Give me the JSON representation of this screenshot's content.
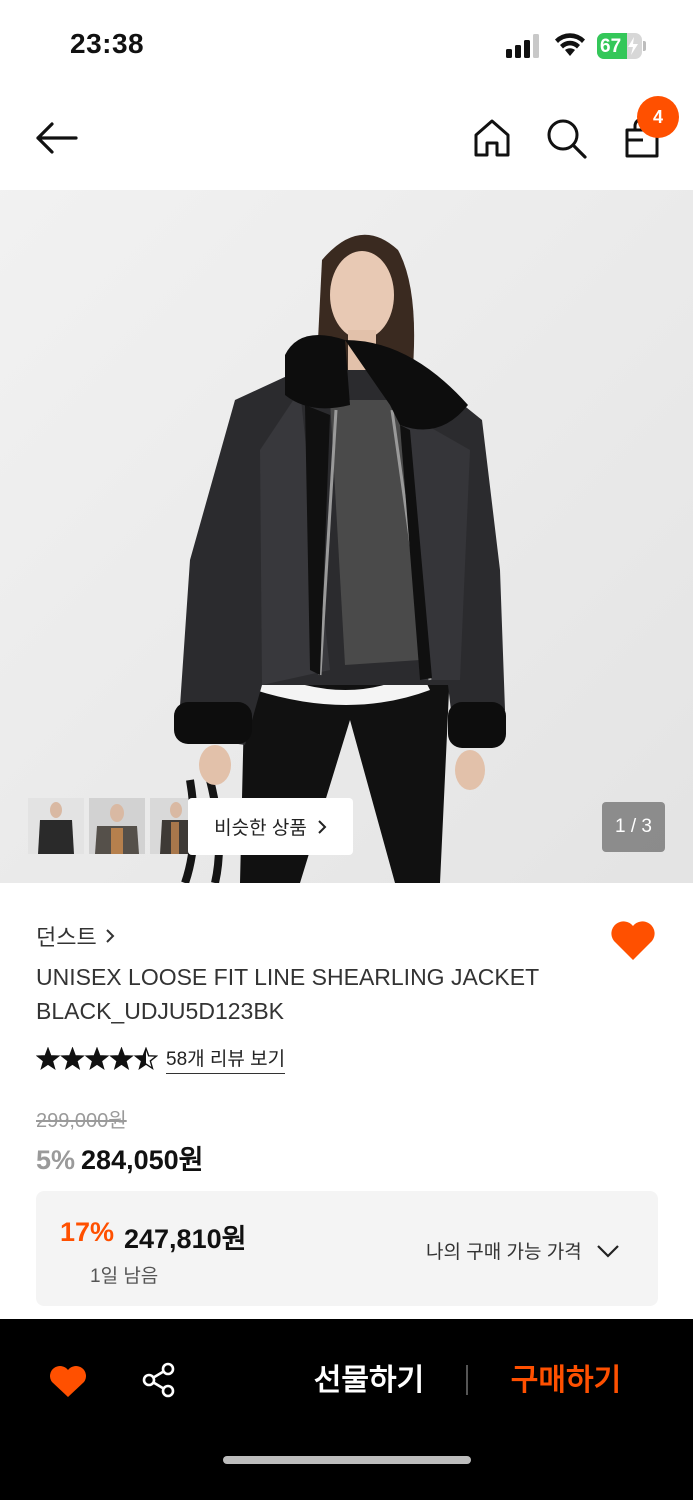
{
  "status_bar": {
    "time": "23:38",
    "battery": "67",
    "battery_level": 0.67
  },
  "header": {
    "cart_count": "4"
  },
  "gallery": {
    "similar_label": "비슷한 상품",
    "counter": "1 / 3"
  },
  "product": {
    "brand": "던스트",
    "name": "UNISEX LOOSE FIT LINE SHEARLING JACKET BLACK_UDJU5D123BK",
    "rating": 4.5,
    "review_link": "58개 리뷰 보기",
    "original_price": "299,000원",
    "discount_rate": "5%",
    "sale_price": "284,050원"
  },
  "coupon": {
    "rate": "17%",
    "price": "247,810원",
    "remaining": "1일 남음",
    "my_price_label": "나의 구매 가능 가격"
  },
  "bottom_bar": {
    "gift_label": "선물하기",
    "buy_label": "구매하기"
  },
  "colors": {
    "accent": "#ff5000",
    "wishlist": "#ff5000",
    "bar_bg": "#000000"
  }
}
